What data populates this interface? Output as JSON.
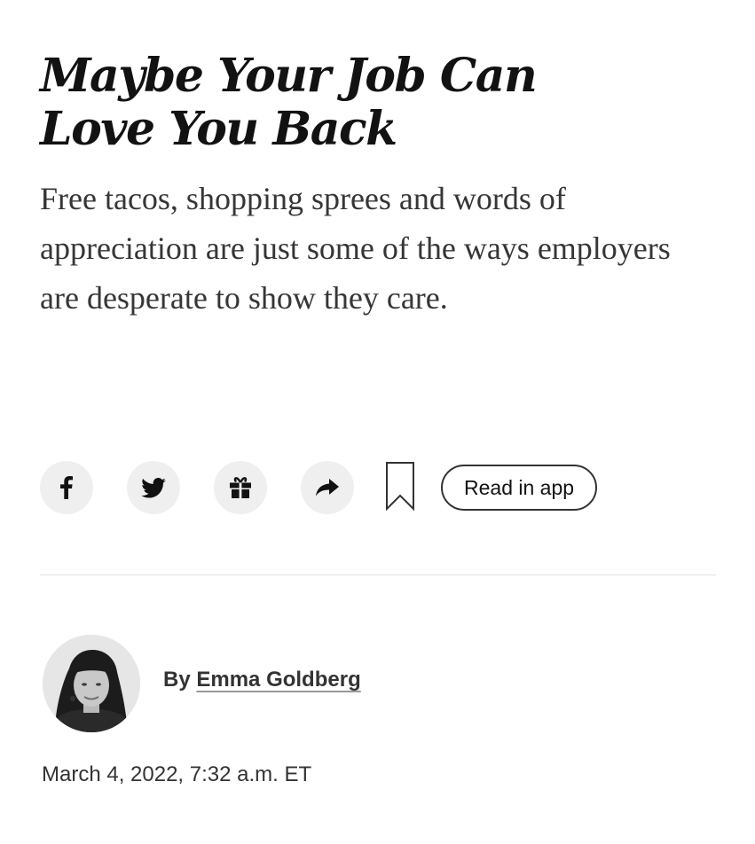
{
  "article": {
    "headline": "Maybe Your Job Can Love You Back",
    "summary": "Free tacos, shopping sprees and words of appreciation are just some of the ways employers are desperate to show they care."
  },
  "share_bar": {
    "icons": {
      "facebook": "facebook-icon",
      "twitter": "twitter-icon",
      "gift": "gift-icon",
      "share": "share-arrow-icon",
      "bookmark": "bookmark-icon"
    },
    "read_in_app_label": "Read in app"
  },
  "byline": {
    "prefix": "By ",
    "author": "Emma Goldberg"
  },
  "timestamp": "March 4, 2022, 7:32 a.m. ET"
}
